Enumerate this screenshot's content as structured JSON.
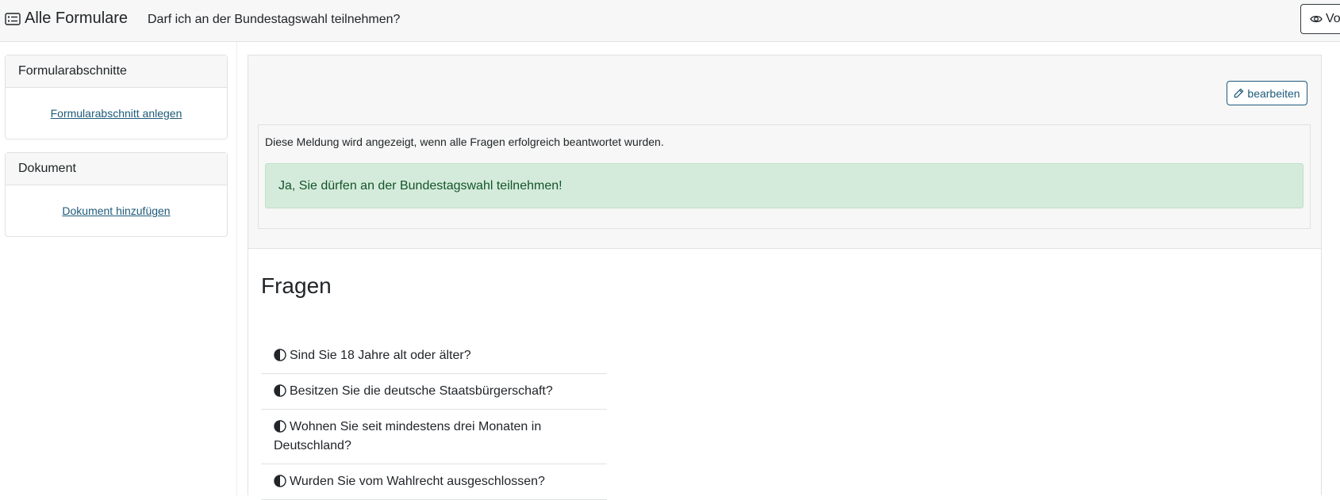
{
  "topbar": {
    "brand_label": "Alle Formulare",
    "form_title": "Darf ich an der Bundestagswahl teilnehmen?",
    "preview_label": "Vorschau",
    "brand_icon": "form-list-icon",
    "preview_icon": "eye-icon"
  },
  "sidebar": {
    "sections_card": {
      "title": "Formularabschnitte",
      "link_label": "Formularabschnitt anlegen"
    },
    "document_card": {
      "title": "Dokument",
      "link_label": "Dokument hinzufügen"
    }
  },
  "main": {
    "edit_label": "bearbeiten",
    "edit_icon": "pencil-icon",
    "completion_hint": "Diese Meldung wird angezeigt, wenn alle Fragen erfolgreich beantwortet wurden.",
    "success_message": "Ja, Sie dürfen an der Bundestagswahl teilnehmen!",
    "questions_title": "Fragen",
    "question_icon": "half-circle-icon",
    "questions": [
      {
        "text": "Sind Sie 18 Jahre alt oder älter?"
      },
      {
        "text": "Besitzen Sie die deutsche Staatsbürgerschaft?"
      },
      {
        "text": "Wohnen Sie seit mindestens drei Monaten in Deutschland?"
      },
      {
        "text": "Wurden Sie vom Wahlrecht ausgeschlossen?"
      }
    ]
  },
  "colors": {
    "accent": "#1e5a7a",
    "success_bg": "#d4ebdb",
    "success_text": "#14542a",
    "panel_bg": "#f6f7f6"
  }
}
